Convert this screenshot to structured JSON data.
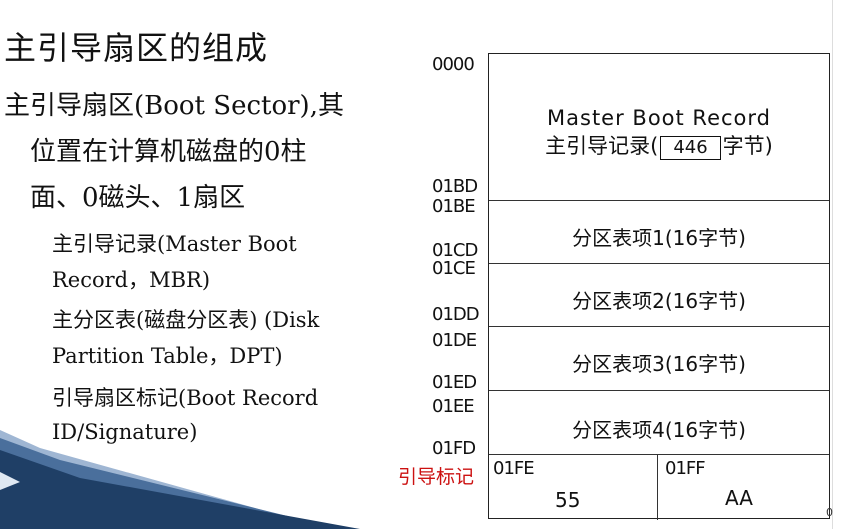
{
  "title": "主引导扇区的组成",
  "bullets": {
    "line1": "主引导扇区(Boot Sector),其",
    "line2": "位置在计算机磁盘的0柱",
    "line3": "面、0磁头、1扇区",
    "sub": [
      "主引导记录(Master Boot",
      "Record，MBR)",
      "主分区表(磁盘分区表) (Disk",
      "Partition Table，DPT)",
      "引导扇区标记(Boot Record",
      "ID/Signature)"
    ]
  },
  "diagram": {
    "addresses": {
      "a0000": "0000",
      "a01BD": "01BD",
      "a01BE": "01BE",
      "a01CD": "01CD",
      "a01CE": "01CE",
      "a01DD": "01DD",
      "a01DE": "01DE",
      "a01ED": "01ED",
      "a01EE": "01EE",
      "a01FD": "01FD",
      "a01FE": "01FE",
      "a01FF": "01FF"
    },
    "mbr_en": "Master Boot Record",
    "mbr_cn_prefix": "主引导记录(",
    "mbr_size": "446",
    "mbr_cn_suffix": "字节)",
    "partitions": [
      "分区表项1(16字节)",
      "分区表项2(16字节)",
      "分区表项3(16字节)",
      "分区表项4(16字节)"
    ],
    "sig_low": "55",
    "sig_high": "AA",
    "sig_label": "引导标记"
  },
  "page_number": "0",
  "colors": {
    "signature_label": "#cc1111",
    "decor_dark": "#1f3f66",
    "decor_light": "#9fb6d3"
  }
}
